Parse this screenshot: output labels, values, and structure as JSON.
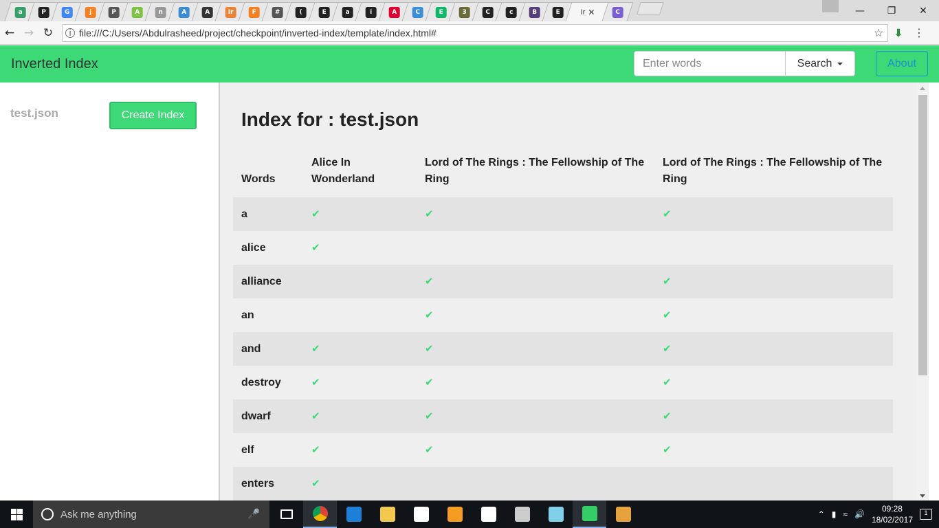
{
  "browser": {
    "tabs": [
      {
        "icon": "reactor-icon",
        "color": "#3b9f6b",
        "glyph": "a"
      },
      {
        "icon": "github-icon",
        "color": "#222222",
        "glyph": "P"
      },
      {
        "icon": "google-icon",
        "color": "#4285f4",
        "glyph": "G"
      },
      {
        "icon": "stackoverflow-icon",
        "color": "#f48024",
        "glyph": "j"
      },
      {
        "icon": "pocket-icon",
        "color": "#555555",
        "glyph": "P"
      },
      {
        "icon": "travis-icon",
        "color": "#7dc242",
        "glyph": "A"
      },
      {
        "icon": "document-icon",
        "color": "#999999",
        "glyph": "n"
      },
      {
        "icon": "kubernetes-icon",
        "color": "#3d8bd0",
        "glyph": "A"
      },
      {
        "icon": "lambda-icon",
        "color": "#333333",
        "glyph": "A"
      },
      {
        "icon": "swagger-icon",
        "color": "#e8833a",
        "glyph": "Ir"
      },
      {
        "icon": "stackoverflow-icon",
        "color": "#f48024",
        "glyph": "F"
      },
      {
        "icon": "hash-icon",
        "color": "#555555",
        "glyph": "#"
      },
      {
        "icon": "github-icon",
        "color": "#222222",
        "glyph": "("
      },
      {
        "icon": "github-icon",
        "color": "#222222",
        "glyph": "E"
      },
      {
        "icon": "github-icon",
        "color": "#222222",
        "glyph": "a"
      },
      {
        "icon": "github-icon",
        "color": "#222222",
        "glyph": "i"
      },
      {
        "icon": "angular-icon",
        "color": "#dd0031",
        "glyph": "A"
      },
      {
        "icon": "gear-icon",
        "color": "#3b8fd9",
        "glyph": "C"
      },
      {
        "icon": "medium-icon",
        "color": "#12b76a",
        "glyph": "E"
      },
      {
        "icon": "photo-icon",
        "color": "#6b6b3a",
        "glyph": "3"
      },
      {
        "icon": "mountain-icon",
        "color": "#222222",
        "glyph": "C"
      },
      {
        "icon": "github-icon",
        "color": "#222222",
        "glyph": "c"
      },
      {
        "icon": "bootstrap-icon",
        "color": "#563d7c",
        "glyph": "B"
      },
      {
        "icon": "mountain-icon",
        "color": "#222222",
        "glyph": "E"
      }
    ],
    "active_tab_label": "Ir",
    "extra_tab": {
      "icon": "circle-icon",
      "color": "#7b5fd1",
      "glyph": "C"
    },
    "url": "file:///C:/Users/Abdulrasheed/project/checkpoint/inverted-index/template/index.html#"
  },
  "navbar": {
    "brand": "Inverted Index",
    "search_placeholder": "Enter words",
    "search_button": "Search",
    "about_button": "About"
  },
  "sidebar": {
    "file_name": "test.json",
    "create_button": "Create Index"
  },
  "main": {
    "title": "Index for : test.json",
    "columns": [
      "Words",
      "Alice In Wonderland",
      "Lord of The Rings : The Fellowship of The Ring",
      "Lord of The Rings : The Fellowship of The Ring"
    ],
    "rows": [
      {
        "word": "a",
        "present": [
          true,
          true,
          true
        ]
      },
      {
        "word": "alice",
        "present": [
          true,
          false,
          false
        ]
      },
      {
        "word": "alliance",
        "present": [
          false,
          true,
          true
        ]
      },
      {
        "word": "an",
        "present": [
          false,
          true,
          true
        ]
      },
      {
        "word": "and",
        "present": [
          true,
          true,
          true
        ]
      },
      {
        "word": "destroy",
        "present": [
          true,
          true,
          true
        ]
      },
      {
        "word": "dwarf",
        "present": [
          true,
          true,
          true
        ]
      },
      {
        "word": "elf",
        "present": [
          true,
          true,
          true
        ]
      },
      {
        "word": "enters",
        "present": [
          true,
          false,
          false
        ]
      }
    ],
    "tick_glyph": "✔",
    "accent_color": "#3dd977"
  },
  "taskbar": {
    "search_placeholder": "Ask me anything",
    "apps": [
      {
        "name": "task-view-icon",
        "color": "#ffffff"
      },
      {
        "name": "chrome-icon",
        "color": "#db4437"
      },
      {
        "name": "edge-icon",
        "color": "#1e7fd9"
      },
      {
        "name": "file-explorer-icon",
        "color": "#f2c94c"
      },
      {
        "name": "store-icon",
        "color": "#ffffff"
      },
      {
        "name": "sublime-icon",
        "color": "#f59b22"
      },
      {
        "name": "postman-icon",
        "color": "#ffffff"
      },
      {
        "name": "terminal-icon",
        "color": "#cccccc"
      },
      {
        "name": "notes-icon",
        "color": "#7fd0e8"
      },
      {
        "name": "torrent-icon",
        "color": "#33cc66"
      },
      {
        "name": "paint-icon",
        "color": "#e6a23c"
      }
    ],
    "time": "09:28",
    "date": "18/02/2017",
    "notification_count": "1"
  }
}
